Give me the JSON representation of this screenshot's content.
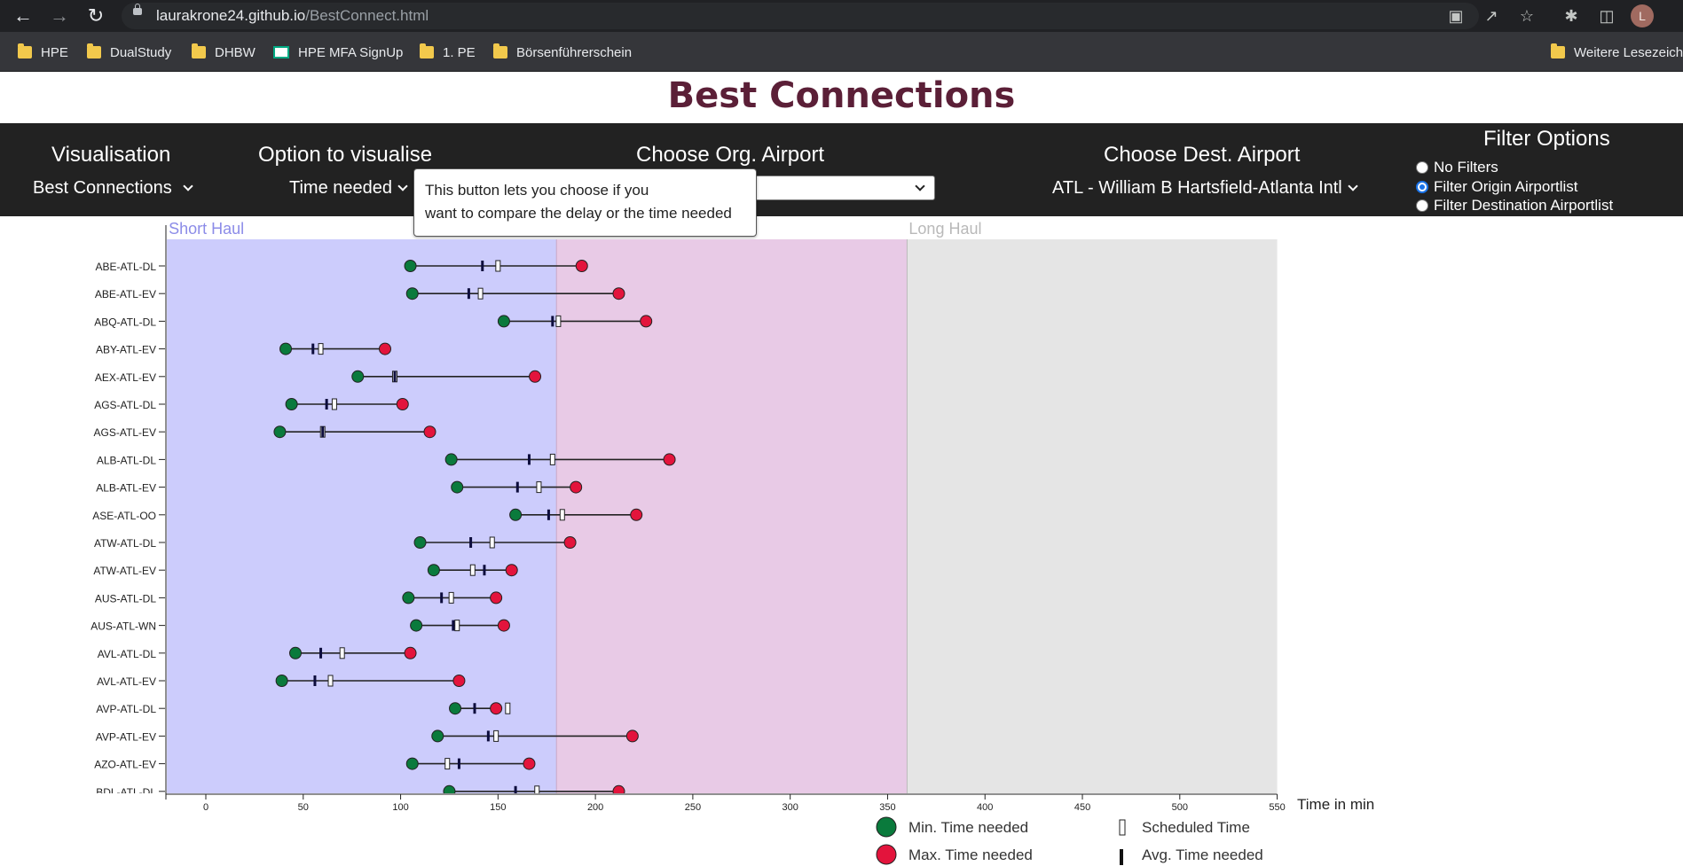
{
  "browser": {
    "url_host": "laurakrone24.github.io",
    "url_path": "/BestConnect.html",
    "profile_initial": "L",
    "bookmarks": [
      {
        "label": "HPE",
        "icon": "folder-icon"
      },
      {
        "label": "DualStudy",
        "icon": "folder-icon"
      },
      {
        "label": "DHBW",
        "icon": "folder-icon"
      },
      {
        "label": "HPE MFA SignUp",
        "icon": "hpe-logo-icon"
      },
      {
        "label": "1. PE",
        "icon": "folder-icon"
      },
      {
        "label": "Börsenführerschein",
        "icon": "folder-icon"
      },
      {
        "label": "Weitere Lesezeichen",
        "icon": "folder-icon"
      }
    ]
  },
  "page": {
    "title": "Best Connections"
  },
  "toolbar": {
    "visualisation_heading": "Visualisation",
    "visualisation_value": "Best Connections",
    "option_heading": "Option to visualise",
    "option_value": "Time needed",
    "org_heading": "Choose Org. Airport",
    "org_value": "",
    "dest_heading": "Choose Dest. Airport",
    "dest_value": "ATL - William B Hartsfield-Atlanta Intl",
    "filter_heading": "Filter Options",
    "filters": [
      {
        "label": "No Filters",
        "checked": false
      },
      {
        "label": "Filter Origin Airportlist",
        "checked": true
      },
      {
        "label": "Filter Destination Airportlist",
        "checked": false
      }
    ]
  },
  "tooltip": {
    "line1": "This button lets you choose if you",
    "line2": "want to compare the delay or the time needed"
  },
  "colors": {
    "short_haul_band": "#ccccfc",
    "mid_band": "#e8cae6",
    "long_haul_band": "#e5e5e5",
    "min_dot": "#0a7a3c",
    "max_dot": "#e3143c",
    "page_title": "#5b1f37",
    "toolbar_bg": "#222222"
  },
  "chart_data": {
    "type": "dumbbell",
    "xlabel": "Time in min",
    "x_ticks": [
      0,
      50,
      100,
      150,
      200,
      250,
      300,
      350,
      400,
      450,
      500,
      550
    ],
    "xlim": [
      -20,
      550
    ],
    "bands": [
      {
        "label": "Short Haul",
        "from": -20,
        "to": 180
      },
      {
        "label": "",
        "from": 180,
        "to": 360
      },
      {
        "label": "Long Haul",
        "from": 360,
        "to": 550
      }
    ],
    "legend": {
      "min": "Min. Time needed",
      "max": "Max. Time needed",
      "scheduled": "Scheduled Time",
      "avg": "Avg. Time needed"
    },
    "rows": [
      {
        "label": "ABE-ATL-DL",
        "min": 105,
        "max": 193,
        "avg": 142,
        "scheduled": 150
      },
      {
        "label": "ABE-ATL-EV",
        "min": 106,
        "max": 212,
        "avg": 135,
        "scheduled": 141
      },
      {
        "label": "ABQ-ATL-DL",
        "min": 153,
        "max": 226,
        "avg": 178,
        "scheduled": 181
      },
      {
        "label": "ABY-ATL-EV",
        "min": 41,
        "max": 92,
        "avg": 55,
        "scheduled": 59
      },
      {
        "label": "AEX-ATL-EV",
        "min": 78,
        "max": 169,
        "avg": 97,
        "scheduled": 97
      },
      {
        "label": "AGS-ATL-DL",
        "min": 44,
        "max": 101,
        "avg": 62,
        "scheduled": 66
      },
      {
        "label": "AGS-ATL-EV",
        "min": 38,
        "max": 115,
        "avg": 60,
        "scheduled": 60
      },
      {
        "label": "ALB-ATL-DL",
        "min": 126,
        "max": 238,
        "avg": 166,
        "scheduled": 178
      },
      {
        "label": "ALB-ATL-EV",
        "min": 129,
        "max": 190,
        "avg": 160,
        "scheduled": 171
      },
      {
        "label": "ASE-ATL-OO",
        "min": 159,
        "max": 221,
        "avg": 176,
        "scheduled": 183
      },
      {
        "label": "ATW-ATL-DL",
        "min": 110,
        "max": 187,
        "avg": 136,
        "scheduled": 147
      },
      {
        "label": "ATW-ATL-EV",
        "min": 117,
        "max": 157,
        "avg": 143,
        "scheduled": 137
      },
      {
        "label": "AUS-ATL-DL",
        "min": 104,
        "max": 149,
        "avg": 121,
        "scheduled": 126
      },
      {
        "label": "AUS-ATL-WN",
        "min": 108,
        "max": 153,
        "avg": 127,
        "scheduled": 129
      },
      {
        "label": "AVL-ATL-DL",
        "min": 46,
        "max": 105,
        "avg": 59,
        "scheduled": 70
      },
      {
        "label": "AVL-ATL-EV",
        "min": 39,
        "max": 130,
        "avg": 56,
        "scheduled": 64
      },
      {
        "label": "AVP-ATL-DL",
        "min": 128,
        "max": 149,
        "avg": 138,
        "scheduled": 155
      },
      {
        "label": "AVP-ATL-EV",
        "min": 119,
        "max": 219,
        "avg": 145,
        "scheduled": 149
      },
      {
        "label": "AZO-ATL-EV",
        "min": 106,
        "max": 166,
        "avg": 130,
        "scheduled": 124
      },
      {
        "label": "BDL-ATL-DL",
        "min": 125,
        "max": 212,
        "avg": 159,
        "scheduled": 170
      }
    ]
  }
}
